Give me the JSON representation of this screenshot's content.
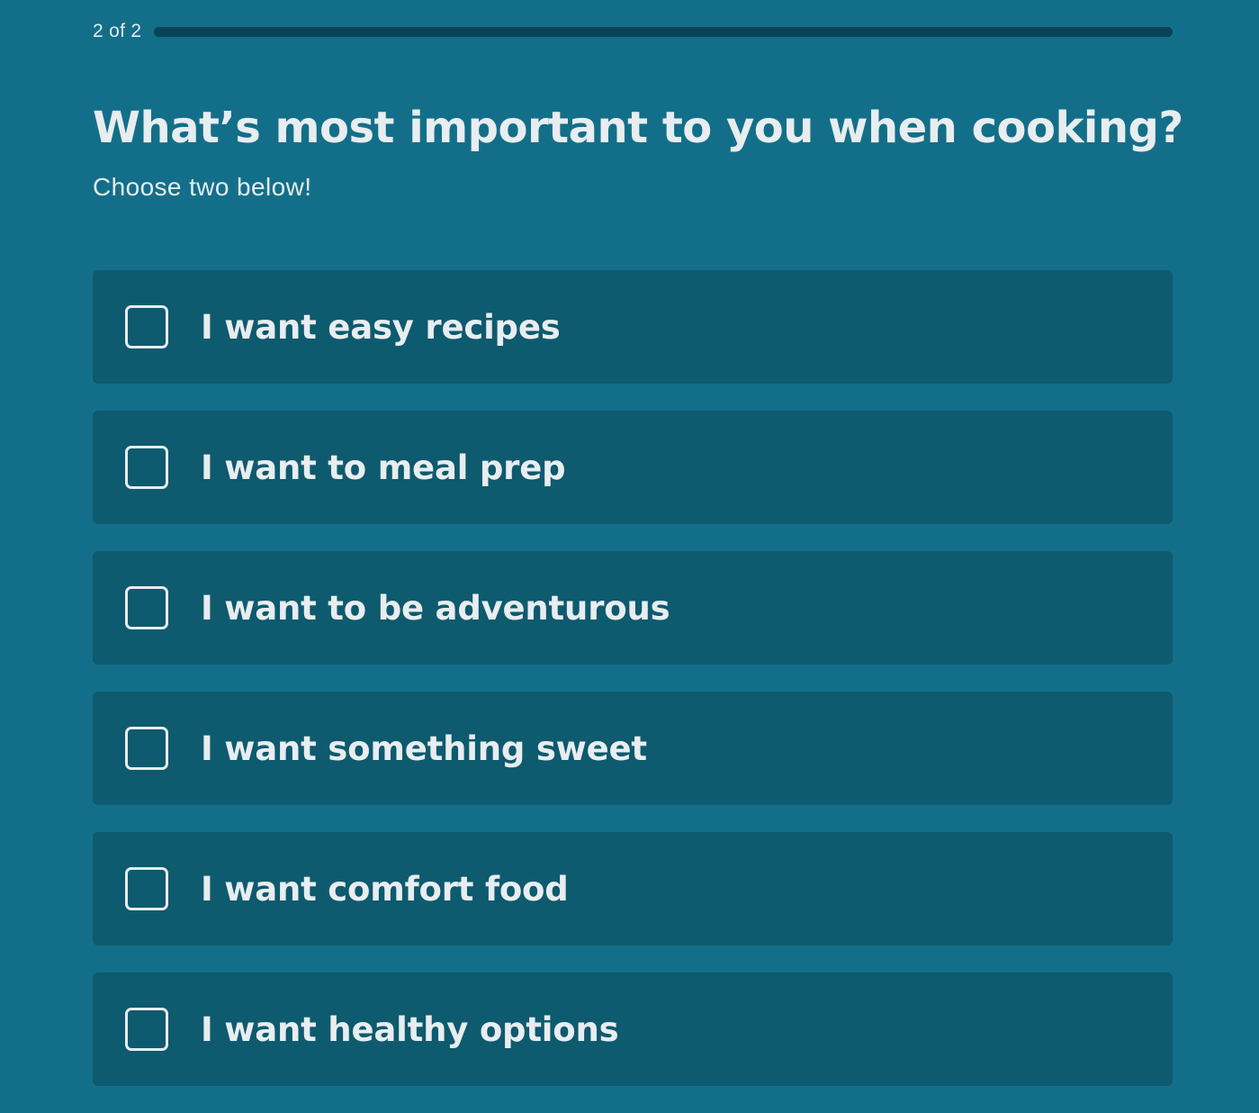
{
  "progress": {
    "counter": "2 of 2",
    "fraction": 1.0
  },
  "question": {
    "title": "What’s most important to you when cooking?",
    "subtitle": "Choose two below!"
  },
  "options": [
    {
      "label": "I want easy recipes",
      "checked": false
    },
    {
      "label": "I want to meal prep",
      "checked": false
    },
    {
      "label": "I want to be adventurous",
      "checked": false
    },
    {
      "label": "I want something sweet",
      "checked": false
    },
    {
      "label": "I want comfort food",
      "checked": false
    },
    {
      "label": "I want healthy options",
      "checked": false
    }
  ],
  "colors": {
    "background": "#136f89",
    "card": "#0e5a6e",
    "progress_track": "#0a4c60",
    "text": "#e8edf0"
  }
}
